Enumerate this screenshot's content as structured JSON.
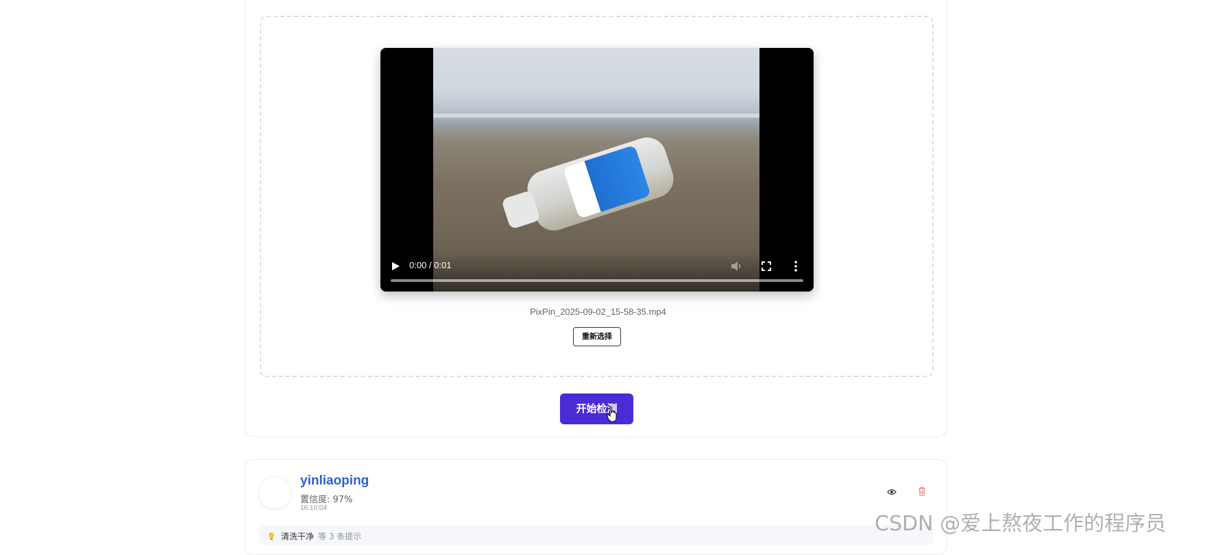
{
  "upload": {
    "video": {
      "time_display": "0:00 / 0:01",
      "progress": 0
    },
    "filename": "PixPin_2025-09-02_15-58-35.mp4",
    "reselect_label": "重新选择"
  },
  "actions": {
    "start_detection_label": "开始检测"
  },
  "result": {
    "name": "yinliaoping",
    "confidence": "置信度: 97%",
    "time": "16:10:04",
    "tip_text": "清洗干净",
    "tip_more": "等 3 条提示"
  },
  "watermark": "CSDN @爱上熬夜工作的程序员",
  "colors": {
    "primary_button": "#4a2bd6",
    "result_name": "#2b5fd9",
    "delete_icon": "#f56c6c"
  },
  "icons": {
    "play": "play-icon",
    "mute": "mute-icon",
    "fullscreen": "fullscreen-icon",
    "more": "more-vert-icon",
    "view": "eye-icon",
    "delete": "trash-icon",
    "tip": "lightbulb-icon",
    "cursor": "hand-cursor-icon"
  }
}
